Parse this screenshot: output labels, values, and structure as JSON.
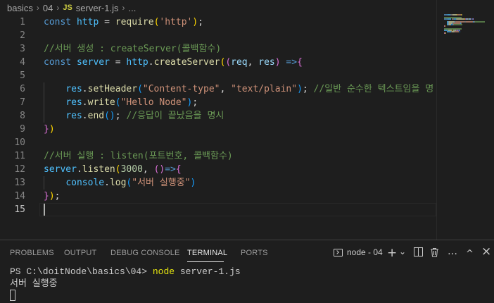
{
  "breadcrumb": {
    "folder1": "basics",
    "folder2": "04",
    "file_badge": "JS",
    "file": "server-1.js",
    "more": "..."
  },
  "editor": {
    "line_numbers": [
      "1",
      "2",
      "3",
      "4",
      "5",
      "6",
      "7",
      "8",
      "9",
      "10",
      "11",
      "12",
      "13",
      "14",
      "15"
    ],
    "lines": [
      [
        [
          "kw",
          "const"
        ],
        [
          "op",
          " "
        ],
        [
          "var",
          "http"
        ],
        [
          "op",
          " = "
        ],
        [
          "fn",
          "require"
        ],
        [
          "p1",
          "("
        ],
        [
          "str",
          "'http'"
        ],
        [
          "p1",
          ")"
        ],
        [
          "op",
          ";"
        ]
      ],
      [],
      [
        [
          "com",
          "//서버 생성 : createServer(콜백함수)"
        ]
      ],
      [
        [
          "kw",
          "const"
        ],
        [
          "op",
          " "
        ],
        [
          "var",
          "server"
        ],
        [
          "op",
          " = "
        ],
        [
          "var",
          "http"
        ],
        [
          "op",
          "."
        ],
        [
          "fn",
          "createServer"
        ],
        [
          "p1",
          "("
        ],
        [
          "p2",
          "("
        ],
        [
          "prop",
          "req"
        ],
        [
          "op",
          ", "
        ],
        [
          "prop",
          "res"
        ],
        [
          "p2",
          ")"
        ],
        [
          "op",
          " "
        ],
        [
          "kw",
          "=>"
        ],
        [
          "p2",
          "{"
        ]
      ],
      [],
      [
        [
          "op",
          "    "
        ],
        [
          "var",
          "res"
        ],
        [
          "op",
          "."
        ],
        [
          "fn",
          "setHeader"
        ],
        [
          "p3",
          "("
        ],
        [
          "str",
          "\"Content-type\""
        ],
        [
          "op",
          ", "
        ],
        [
          "str",
          "\"text/plain\""
        ],
        [
          "p3",
          ")"
        ],
        [
          "op",
          "; "
        ],
        [
          "com",
          "//일반 순수한 텍스트임을 명"
        ]
      ],
      [
        [
          "op",
          "    "
        ],
        [
          "var",
          "res"
        ],
        [
          "op",
          "."
        ],
        [
          "fn",
          "write"
        ],
        [
          "p3",
          "("
        ],
        [
          "str",
          "\"Hello Node\""
        ],
        [
          "p3",
          ")"
        ],
        [
          "op",
          ";"
        ]
      ],
      [
        [
          "op",
          "    "
        ],
        [
          "var",
          "res"
        ],
        [
          "op",
          "."
        ],
        [
          "fn",
          "end"
        ],
        [
          "p3",
          "()"
        ],
        [
          "op",
          "; "
        ],
        [
          "com",
          "//응답이 끝났음을 명시"
        ]
      ],
      [
        [
          "p2",
          "}"
        ],
        [
          "p1",
          ")"
        ]
      ],
      [],
      [
        [
          "com",
          "//서버 실행 : listen(포트번호, 콜백함수)"
        ]
      ],
      [
        [
          "var",
          "server"
        ],
        [
          "op",
          "."
        ],
        [
          "fn",
          "listen"
        ],
        [
          "p1",
          "("
        ],
        [
          "num",
          "3000"
        ],
        [
          "op",
          ", "
        ],
        [
          "p2",
          "()"
        ],
        [
          "kw",
          "=>"
        ],
        [
          "p2",
          "{"
        ]
      ],
      [
        [
          "op",
          "    "
        ],
        [
          "var",
          "console"
        ],
        [
          "op",
          "."
        ],
        [
          "fn",
          "log"
        ],
        [
          "p3",
          "("
        ],
        [
          "str",
          "\"서버 실행중\""
        ],
        [
          "p3",
          ")"
        ]
      ],
      [
        [
          "p2",
          "}"
        ],
        [
          "p1",
          ")"
        ],
        [
          "op",
          ";"
        ]
      ],
      []
    ]
  },
  "panel": {
    "tabs": [
      "PROBLEMS",
      "OUTPUT",
      "DEBUG CONSOLE",
      "TERMINAL",
      "PORTS"
    ],
    "active_tab": "TERMINAL",
    "terminal_name": "node - 04",
    "add_icon": "+",
    "dropdown_icon": "⌄",
    "split_icon": "split-icon",
    "trash_icon": "trash-icon",
    "more_icon": "…",
    "maximize_icon": "^",
    "close_icon": "×"
  },
  "terminal": {
    "prompt": "PS C:\\doitNode\\basics\\04> ",
    "command": "node",
    "argument": " server-1.js",
    "output": "서버 실행중"
  },
  "colors": {
    "background": "#1e1e1e",
    "keyword": "#569cd6",
    "string": "#ce9178",
    "comment": "#6a9955"
  }
}
